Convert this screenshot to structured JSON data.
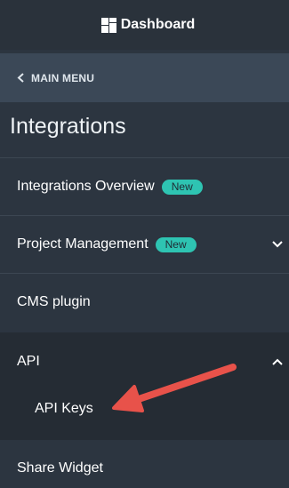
{
  "header": {
    "logo_icon": "dashboard-grid-icon",
    "title": "Dashboard"
  },
  "back_link": {
    "icon": "chevron-left-icon",
    "label": "MAIN MENU"
  },
  "section": {
    "title": "Integrations"
  },
  "nav": {
    "items": [
      {
        "label": "Integrations Overview",
        "badge": "New"
      },
      {
        "label": "Project Management",
        "badge": "New",
        "icon": "chevron-down-icon"
      },
      {
        "label": "CMS plugin"
      },
      {
        "label": "API",
        "icon": "chevron-up-icon",
        "expanded": true,
        "children": [
          {
            "label": "API Keys"
          }
        ]
      },
      {
        "label": "Share Widget"
      }
    ]
  },
  "annotation": {
    "arrow_color": "#e8524a",
    "arrow_icon": "pointer-arrow-icon"
  },
  "colors": {
    "background": "#2c3540",
    "back_bar": "#3b4857",
    "badge": "#2ec4b2",
    "expanded_group": "#252c34"
  }
}
